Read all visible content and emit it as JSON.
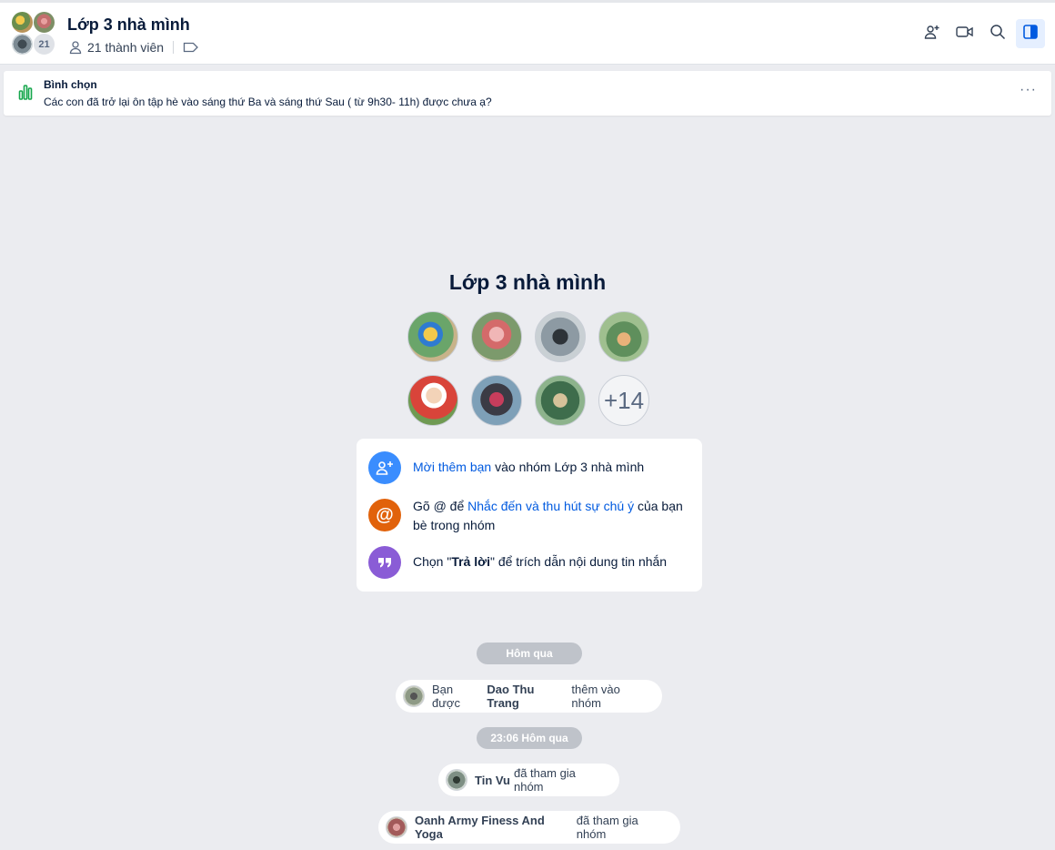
{
  "header": {
    "title": "Lớp 3 nhà mình",
    "avatar_count": "21",
    "member_count": "21 thành viên"
  },
  "poll": {
    "title": "Bình chọn",
    "question": "Các con đã trở lại ôn tập hè vào sáng thứ Ba và sáng thứ Sau ( từ 9h30- 11h) được chưa ạ?",
    "more": "···"
  },
  "intro": {
    "group_name": "Lớp 3 nhà mình",
    "more_members": "+14",
    "tips": {
      "invite_link": "Mời thêm bạn",
      "invite_rest": " vào nhóm Lớp 3 nhà mình",
      "mention_pre": "Gõ @ để ",
      "mention_link": "Nhắc đến và thu hút sự chú ý",
      "mention_rest": " của bạn bè trong nhóm",
      "reply_pre": "Chọn \"",
      "reply_bold": "Trả lời",
      "reply_rest": "\" để trích dẫn nội dung tin nhắn"
    }
  },
  "timeline": {
    "divider1": "Hôm qua",
    "event1": {
      "pre": "Bạn được",
      "name": "Dao Thu Trang",
      "rest": "thêm vào nhóm"
    },
    "divider2": "23:06 Hôm qua",
    "event2": {
      "name": "Tin Vu",
      "rest": "đã tham gia nhóm"
    },
    "event3": {
      "name": "Oanh Army Finess And Yoga",
      "rest": "đã tham gia nhóm"
    }
  },
  "colors": {
    "accent": "#005ae0",
    "invite_icon_bg": "#3a8dfe",
    "mention_icon_bg": "#e1620b",
    "reply_icon_bg": "#8a5cd6",
    "poll_icon": "#15a64c"
  },
  "icons": [
    "add-member-icon",
    "video-call-icon",
    "search-icon",
    "sidebar-toggle-icon",
    "person-icon",
    "tag-icon",
    "poll-chart-icon"
  ]
}
